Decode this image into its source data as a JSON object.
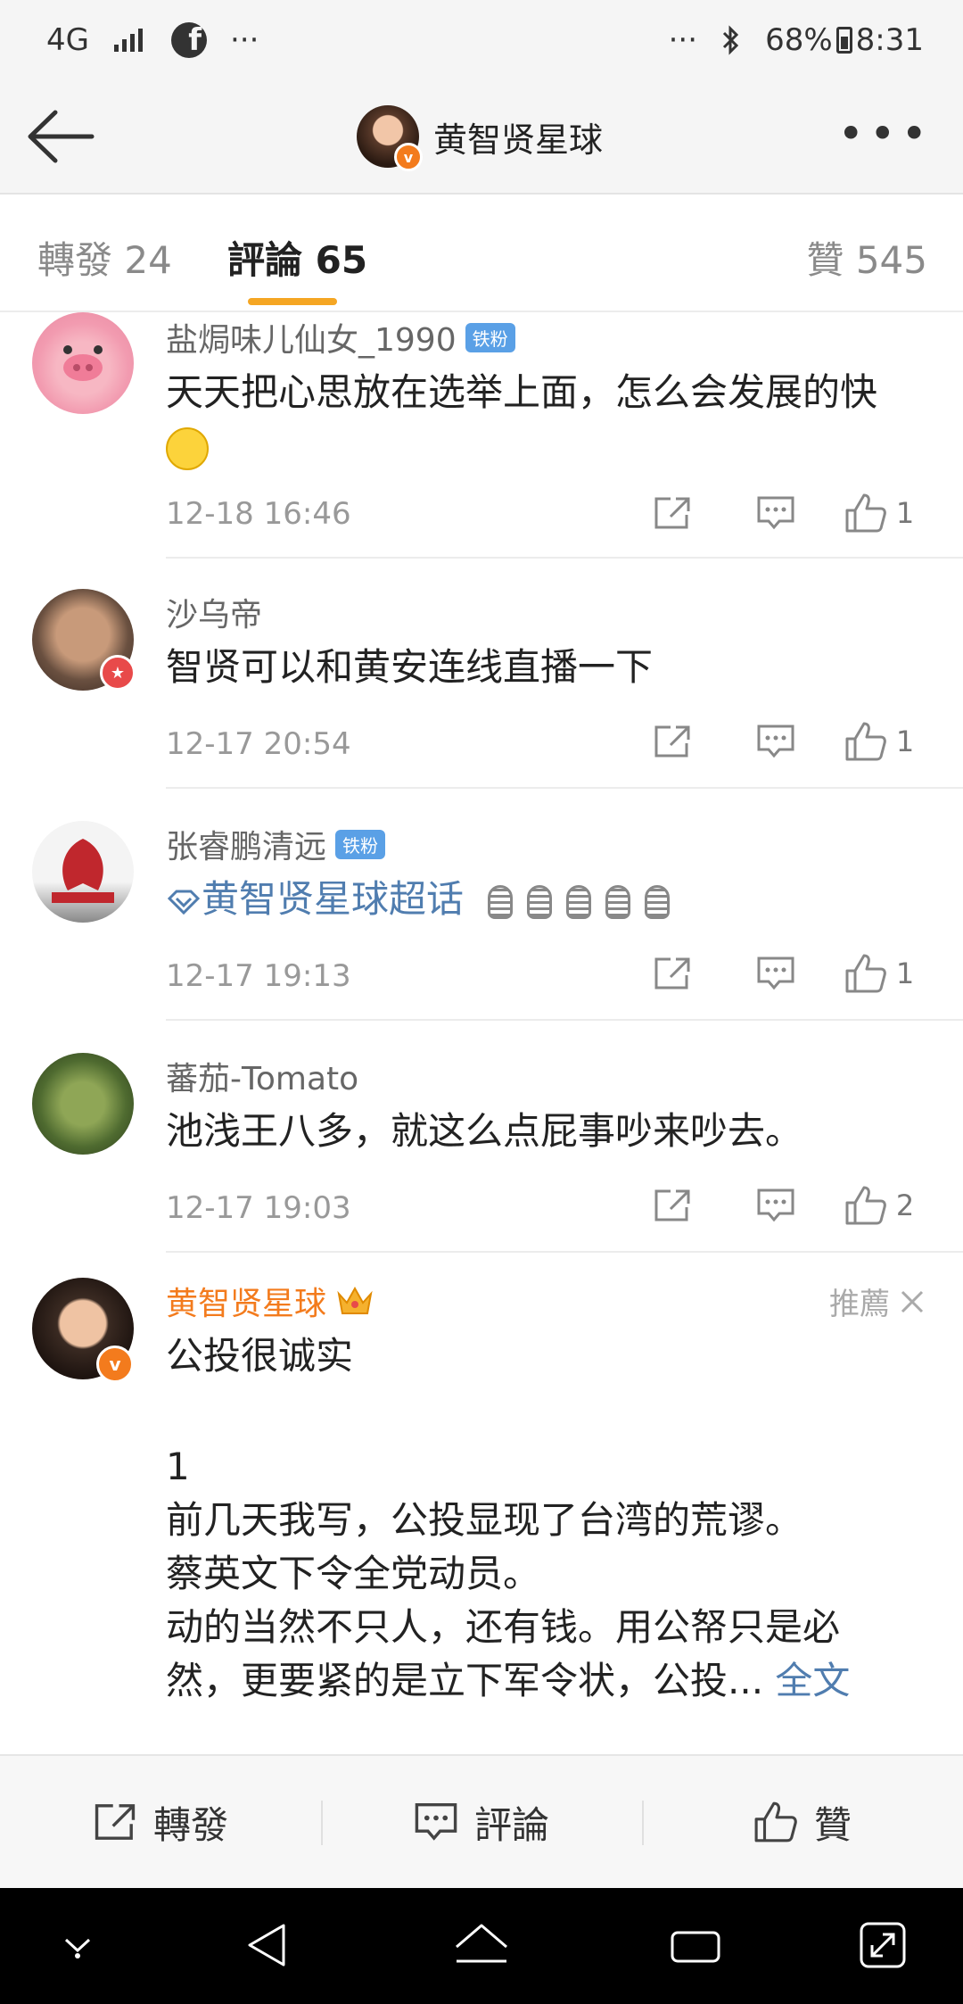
{
  "status_bar": {
    "network": "4G",
    "dots_left": "···",
    "dots_right": "···",
    "battery": "68%",
    "time": "8:31"
  },
  "nav": {
    "title": "黄智贤星球",
    "more": "•••"
  },
  "tabs": {
    "repost": "轉發 24",
    "comments": "評論 65",
    "likes": "贊 545"
  },
  "comments": [
    {
      "user": "盐焗味儿仙女_1990",
      "badge": "铁粉",
      "text": "天天把心思放在选举上面，怎么会发展的快",
      "time": "12-18 16:46",
      "likes": "1"
    },
    {
      "user": "沙乌帝",
      "text": "智贤可以和黄安连线直播一下",
      "time": "12-17 20:54",
      "likes": "1"
    },
    {
      "user": "张睿鹏清远",
      "badge": "铁粉",
      "text": "黄智贤星球超话",
      "time": "12-17 19:13",
      "likes": "1"
    },
    {
      "user": "蕃茄-Tomato",
      "text": "池浅王八多，就这么点屁事吵来吵去。",
      "time": "12-17 19:03",
      "likes": "2"
    },
    {
      "user": "黄智贤星球",
      "recommend": "推薦",
      "lines": [
        "公投很诚实",
        "",
        "1",
        "前几天我写，公投显现了台湾的荒谬。",
        "蔡英文下令全党动员。",
        "动的当然不只人，还有钱。用公帑只是必",
        "然，更要紧的是立下军令状，公投..."
      ],
      "expand": "全文"
    }
  ],
  "bottom_bar": {
    "repost": "轉發",
    "comment": "評論",
    "like": "贊"
  },
  "colors": {
    "accent": "#f5a623",
    "link": "#507daf",
    "vip_orange": "#f37b1d"
  }
}
